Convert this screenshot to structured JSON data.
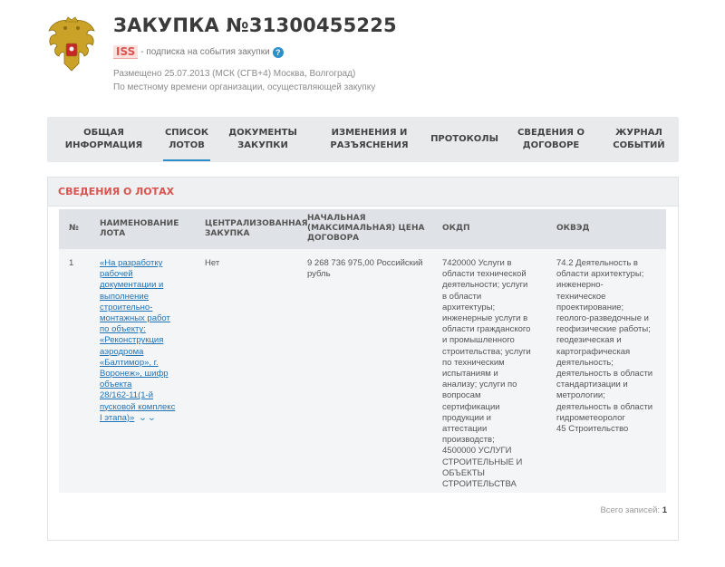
{
  "header": {
    "title": "ЗАКУПКА №31300455225",
    "badge": "ISS",
    "subscribe_text": "- подписка на события закупки",
    "help_icon": "question-circle-icon",
    "published": "Размещено 25.07.2013 (МСК (СГВ+4) Москва, Волгоград)",
    "timezone_note": "По местному времени организации, осуществляющей закупку",
    "emblem": "russian-coat-of-arms-icon"
  },
  "tabs": [
    {
      "line1": "ОБЩАЯ",
      "line2": "ИНФОРМАЦИЯ",
      "active": false
    },
    {
      "line1": "СПИСОК",
      "line2": "ЛОТОВ",
      "active": true
    },
    {
      "line1": "ДОКУМЕНТЫ",
      "line2": "ЗАКУПКИ",
      "active": false
    },
    {
      "line1": "ИЗМЕНЕНИЯ И",
      "line2": "РАЗЪЯСНЕНИЯ",
      "active": false
    },
    {
      "line1": "ПРОТОКОЛЫ",
      "line2": "",
      "active": false
    },
    {
      "line1": "СВЕДЕНИЯ О",
      "line2": "ДОГОВОРЕ",
      "active": false
    },
    {
      "line1": "ЖУРНАЛ",
      "line2": "СОБЫТИЙ",
      "active": false
    }
  ],
  "lots": {
    "title": "СВЕДЕНИЯ О ЛОТАХ",
    "columns": {
      "num": "№",
      "name": [
        "НАИМЕНОВАНИЕ",
        "ЛОТА"
      ],
      "central": [
        "ЦЕНТРАЛИЗОВАННАЯ",
        "ЗАКУПКА"
      ],
      "price": [
        "НАЧАЛЬНАЯ",
        "(МАКСИМАЛЬНАЯ) ЦЕНА",
        "ДОГОВОРА"
      ],
      "okdp": "ОКДП",
      "okved": "ОКВЭД"
    },
    "row": {
      "num": "1",
      "name_lines": [
        "«На разработку",
        "рабочей",
        "документации и",
        "выполнение",
        "строительно-",
        "монтажных работ",
        "по объекту:",
        "«Реконструкция",
        "аэродрома",
        "«Балтимор», г.",
        "Воронеж», шифр",
        "объекта",
        "28/162-11(1-й",
        "пусковой комплекс",
        "I этапа)»"
      ],
      "central": "Нет",
      "price_lines": [
        "9 268 736 975,00 Российский",
        "рубль"
      ],
      "okdp_lines": [
        "7420000 Услуги в",
        "области технической",
        "деятельности; услуги",
        "в области",
        "архитектуры;",
        "инженерные услуги в",
        "области гражданского",
        "и промышленного",
        "строительства; услуги",
        "по техническим",
        "испытаниям и",
        "анализу; услуги по",
        "вопросам",
        "сертификации",
        "продукции и",
        "аттестации",
        "производств;",
        "4500000 УСЛУГИ",
        "СТРОИТЕЛЬНЫЕ И",
        "ОБЪЕКТЫ",
        "СТРОИТЕЛЬСТВА"
      ],
      "okved_lines": [
        "74.2 Деятельность в",
        "области архитектуры;",
        "инженерно-",
        "техническое",
        "проектирование;",
        "геолого-разведочные и",
        "геофизические работы;",
        "геодезическая и",
        "картографическая",
        "деятельность;",
        "деятельность в области",
        "стандартизации и",
        "метрологии;",
        "деятельность в области",
        "гидрометеоролог",
        "45 Строительство"
      ],
      "expand_icon": "double-chevron-down-icon"
    },
    "total_label": "Всего записей:",
    "total_value": "1"
  }
}
